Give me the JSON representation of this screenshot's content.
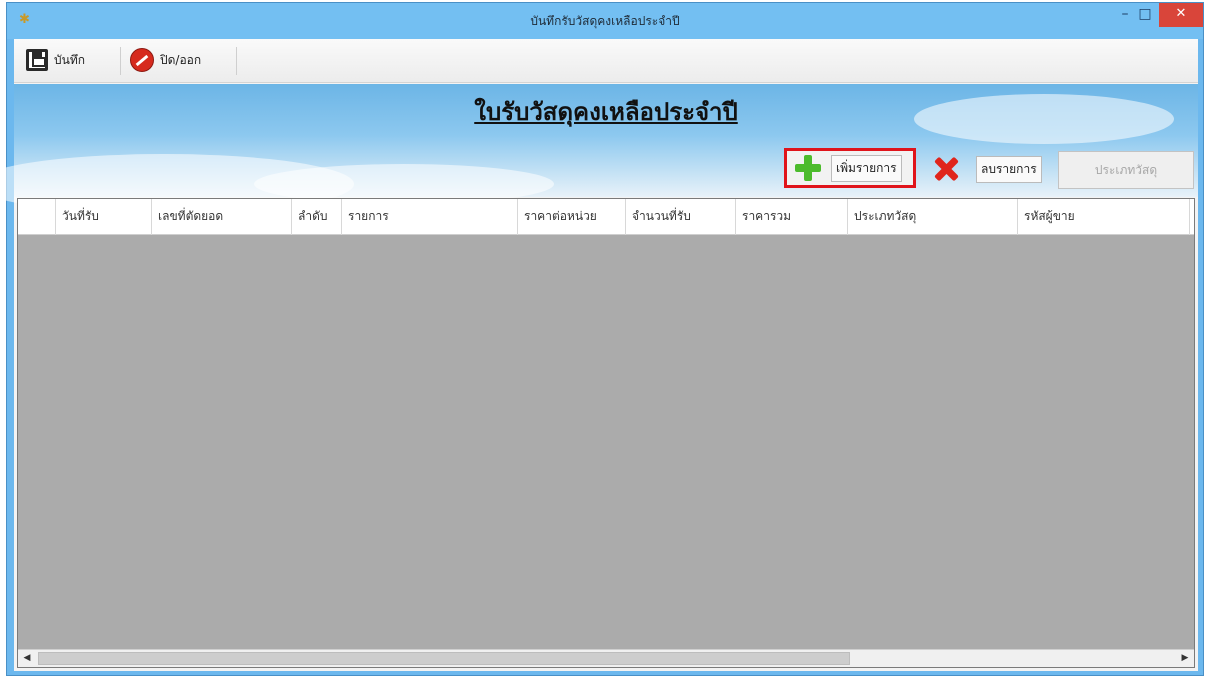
{
  "window": {
    "title": "บันทึกรับวัสดุคงเหลือประจำปี",
    "minimize_glyph": "–",
    "maximize_glyph": "□",
    "close_glyph": "✕",
    "app_icon": "app-icon"
  },
  "toolbar": {
    "save_label": "บันทึก",
    "save_icon": "floppy-disk-icon",
    "close_label": "ปิด/ออก",
    "close_icon": "stop-icon"
  },
  "form": {
    "title": "ใบรับวัสดุคงเหลือประจำปี",
    "add_label": "เพิ่มรายการ",
    "delete_label": "ลบรายการ",
    "type_label": "ประเภทวัสดุ"
  },
  "grid": {
    "columns": [
      "วันที่รับ",
      "เลขที่ตัดยอด",
      "ลำดับ",
      "รายการ",
      "ราคาต่อหน่วย",
      "จำนวนที่รับ",
      "ราคารวม",
      "ประเภทวัสดุ",
      "รหัสผู้ขาย"
    ],
    "rows": []
  },
  "colors": {
    "titlebar": "#73bff2",
    "close_button": "#d9453a",
    "highlight_border": "#e0141b",
    "grid_background": "#ababab"
  }
}
